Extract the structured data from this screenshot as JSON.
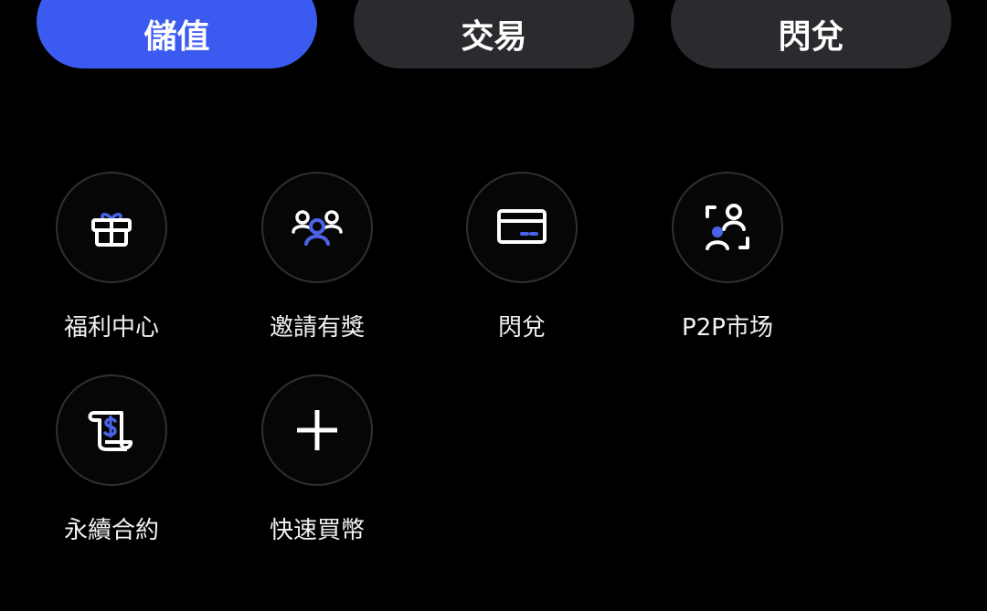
{
  "top_buttons": {
    "deposit": "儲值",
    "trade": "交易",
    "flash_exchange": "閃兌"
  },
  "colors": {
    "accent": "#3b5bf0",
    "pill_bg": "#2a2b2e",
    "icon_blue": "#4a63e8",
    "background": "#000000"
  },
  "grid": {
    "items": [
      {
        "label": "福利中心",
        "icon": "gift-icon"
      },
      {
        "label": "邀請有獎",
        "icon": "invite-users-icon"
      },
      {
        "label": "閃兌",
        "icon": "card-icon"
      },
      {
        "label": "P2P市场",
        "icon": "p2p-users-icon"
      },
      {
        "label": "永續合約",
        "icon": "contract-scroll-icon"
      },
      {
        "label": "快速買幣",
        "icon": "plus-icon"
      }
    ]
  }
}
